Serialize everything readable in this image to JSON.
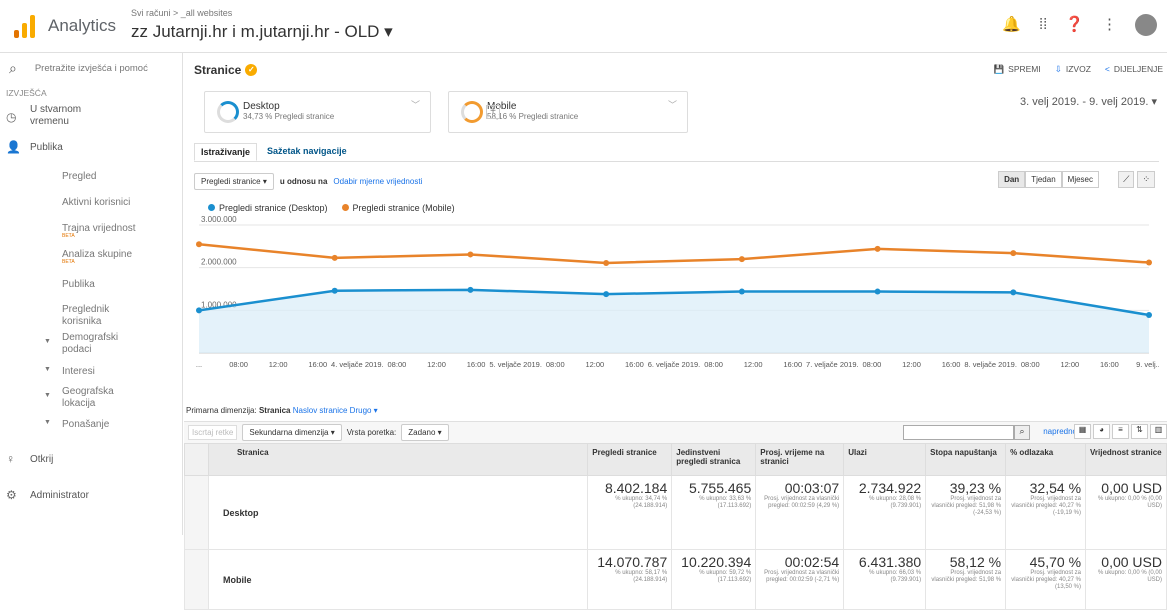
{
  "header": {
    "app_name": "Analytics",
    "breadcrumb": "Svi računi > _all websites",
    "property_title": "zz Jutarnji.hr i m.jutarnji.hr - OLD ▾"
  },
  "sidebar": {
    "search_placeholder": "Pretražite izvješća i pomoć",
    "section_label": "IZVJEŠĆA",
    "items": [
      {
        "label": "U stvarnom vremenu"
      },
      {
        "label": "Publika"
      }
    ],
    "audience_sub": [
      {
        "label": "Pregled"
      },
      {
        "label": "Aktivni korisnici"
      },
      {
        "label": "Trajna vrijednost",
        "badge": "BETA"
      },
      {
        "label": "Analiza skupine",
        "badge": "BETA"
      },
      {
        "label": "Publika"
      },
      {
        "label": "Preglednik korisnika"
      },
      {
        "label": "Demografski podaci"
      },
      {
        "label": "Interesi"
      },
      {
        "label": "Geografska lokacija"
      },
      {
        "label": "Ponašanje"
      }
    ],
    "discover": "Otkrij",
    "admin": "Administrator"
  },
  "report": {
    "title": "Stranice",
    "actions": {
      "save": "SPREMI",
      "export": "IZVOZ",
      "share": "DIJELJENJE"
    },
    "date_range": "3. velj 2019. - 9. velj 2019.",
    "segments": [
      {
        "name": "Desktop",
        "sub": "34,73 % Pregledi stranice",
        "color": "#1a8fcf"
      },
      {
        "name": "Mobile",
        "sub": "58,16 % Pregledi stranice",
        "color": "#f29b30"
      }
    ],
    "tabs": [
      "Istraživanje",
      "Sažetak navigacije"
    ],
    "metric_select": "Pregledi stranice",
    "compare_label": "u odnosu na",
    "compare_link": "Odabir mjerne vrijednosti",
    "granularity": [
      "Dan",
      "Tjedan",
      "Mjesec"
    ],
    "dimension_label": "Primarna dimenzija:",
    "dimension_options": [
      "Stranica",
      "Naslov stranice",
      "Drugo ▾"
    ],
    "toolbar": {
      "plot_rows": "Iscrtaj retke",
      "secondary_dim": "Sekundarna dimenzija",
      "sort_label": "Vrsta poretka:",
      "sort_value": "Zadano",
      "advanced": "napredno"
    }
  },
  "chart_data": {
    "type": "line",
    "title": "",
    "series": [
      {
        "name": "Pregledi stranice (Desktop)",
        "color": "#1a8fcf",
        "values": [
          1000000,
          1460000,
          1480000,
          1380000,
          1440000,
          1440000,
          1420000,
          890000
        ]
      },
      {
        "name": "Pregledi stranice (Mobile)",
        "color": "#e8832a",
        "values": [
          2550000,
          2230000,
          2310000,
          2110000,
          2200000,
          2440000,
          2340000,
          2120000
        ]
      }
    ],
    "y_ticks": [
      "3.000.000",
      "2.000.000",
      "1.000.000"
    ],
    "ylim": [
      0,
      3000000
    ],
    "x_tick_labels": [
      "...",
      "08:00",
      "12:00",
      "16:00",
      "4. veljače 2019.",
      "08:00",
      "12:00",
      "16:00",
      "5. veljače 2019.",
      "08:00",
      "12:00",
      "16:00",
      "6. veljače 2019.",
      "08:00",
      "12:00",
      "16:00",
      "7. veljače 2019.",
      "08:00",
      "12:00",
      "16:00",
      "8. veljače 2019.",
      "08:00",
      "12:00",
      "16:00",
      "9. velj..."
    ],
    "grid": true,
    "legend": "top-left"
  },
  "table": {
    "columns": [
      "Stranica",
      "Pregledi stranice",
      "Jedinstveni pregledi stranica",
      "Prosj. vrijeme na stranici",
      "Ulazi",
      "Stopa napuštanja",
      "% odlazaka",
      "Vrijednost stranice"
    ],
    "rows": [
      {
        "name": "Desktop",
        "cells": [
          {
            "big": "8.402.184",
            "small": "% ukupno: 34,74 % (24.188.914)"
          },
          {
            "big": "5.755.465",
            "small": "% ukupno: 33,63 % (17.113.692)"
          },
          {
            "big": "00:03:07",
            "small": "Prosj. vrijednost za vlasnički pregled: 00:02:59 (4,29 %)"
          },
          {
            "big": "2.734.922",
            "small": "% ukupno: 28,08 % (9.739.901)"
          },
          {
            "big": "39,23 %",
            "small": "Prosj. vrijednost za vlasnički pregled: 51,98 % (-24,53 %)"
          },
          {
            "big": "32,54 %",
            "small": "Prosj. vrijednost za vlasnički pregled: 40,27 % (-19,19 %)"
          },
          {
            "big": "0,00 USD",
            "small": "% ukupno: 0,00 % (0,00 USD)"
          }
        ]
      },
      {
        "name": "Mobile",
        "cells": [
          {
            "big": "14.070.787",
            "small": "% ukupno: 58,17 % (24.188.914)"
          },
          {
            "big": "10.220.394",
            "small": "% ukupno: 59,72 % (17.113.692)"
          },
          {
            "big": "00:02:54",
            "small": "Prosj. vrijednost za vlasnički pregled: 00:02:59 (-2,71 %)"
          },
          {
            "big": "6.431.380",
            "small": "% ukupno: 66,03 % (9.739.901)"
          },
          {
            "big": "58,12 %",
            "small": "Prosj. vrijednost za vlasnički pregled: 51,98 %"
          },
          {
            "big": "45,70 %",
            "small": "Prosj. vrijednost za vlasnički pregled: 40,27 % (13,50 %)"
          },
          {
            "big": "0,00 USD",
            "small": "% ukupno: 0,00 % (0,00 USD)"
          }
        ]
      }
    ]
  }
}
